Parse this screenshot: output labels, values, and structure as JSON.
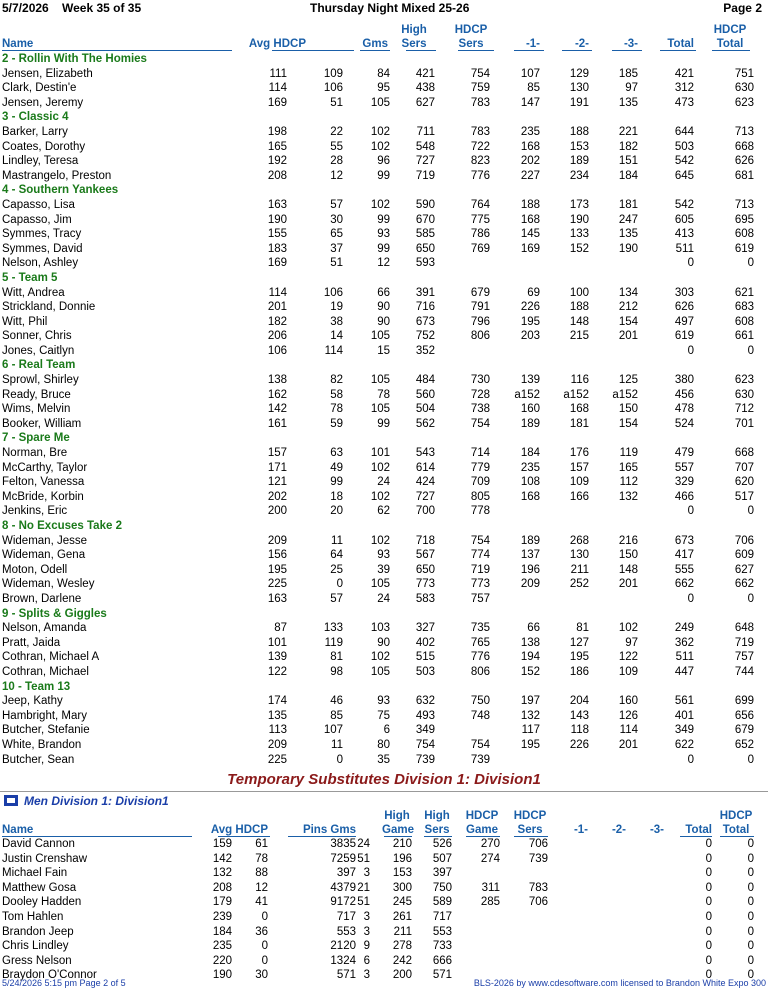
{
  "header": {
    "date": "5/7/2026",
    "week": "Week 35 of 35",
    "title": "Thursday Night Mixed 25-26",
    "page": "Page 2"
  },
  "columns": {
    "name": "Name",
    "avg_hdcp": "Avg HDCP",
    "gms": "Gms",
    "high_sers": "High Sers",
    "hdcp_sers": "HDCP Sers",
    "g1": "-1-",
    "g2": "-2-",
    "g3": "-3-",
    "total": "Total",
    "hdcp_total": "HDCP Total"
  },
  "teams": [
    {
      "name": "2 - Rollin With The Homies",
      "bowlers": [
        [
          "Jensen, Elizabeth",
          "111",
          "109",
          "84",
          "421",
          "754",
          "107",
          "129",
          "185",
          "421",
          "751"
        ],
        [
          "Clark, Destin'e",
          "114",
          "106",
          "95",
          "438",
          "759",
          "85",
          "130",
          "97",
          "312",
          "630"
        ],
        [
          "Jensen, Jeremy",
          "169",
          "51",
          "105",
          "627",
          "783",
          "147",
          "191",
          "135",
          "473",
          "623"
        ]
      ]
    },
    {
      "name": "3 - Classic 4",
      "bowlers": [
        [
          "Barker, Larry",
          "198",
          "22",
          "102",
          "711",
          "783",
          "235",
          "188",
          "221",
          "644",
          "713"
        ],
        [
          "Coates, Dorothy",
          "165",
          "55",
          "102",
          "548",
          "722",
          "168",
          "153",
          "182",
          "503",
          "668"
        ],
        [
          "Lindley, Teresa",
          "192",
          "28",
          "96",
          "727",
          "823",
          "202",
          "189",
          "151",
          "542",
          "626"
        ],
        [
          "Mastrangelo, Preston",
          "208",
          "12",
          "99",
          "719",
          "776",
          "227",
          "234",
          "184",
          "645",
          "681"
        ]
      ]
    },
    {
      "name": "4 - Southern Yankees",
      "bowlers": [
        [
          "Capasso, Lisa",
          "163",
          "57",
          "102",
          "590",
          "764",
          "188",
          "173",
          "181",
          "542",
          "713"
        ],
        [
          "Capasso, Jim",
          "190",
          "30",
          "99",
          "670",
          "775",
          "168",
          "190",
          "247",
          "605",
          "695"
        ],
        [
          "Symmes, Tracy",
          "155",
          "65",
          "93",
          "585",
          "786",
          "145",
          "133",
          "135",
          "413",
          "608"
        ],
        [
          "Symmes, David",
          "183",
          "37",
          "99",
          "650",
          "769",
          "169",
          "152",
          "190",
          "511",
          "619"
        ],
        [
          "Nelson, Ashley",
          "169",
          "51",
          "12",
          "593",
          "",
          "",
          "",
          "",
          "0",
          "0"
        ]
      ]
    },
    {
      "name": "5 - Team 5",
      "bowlers": [
        [
          "Witt, Andrea",
          "114",
          "106",
          "66",
          "391",
          "679",
          "69",
          "100",
          "134",
          "303",
          "621"
        ],
        [
          "Strickland, Donnie",
          "201",
          "19",
          "90",
          "716",
          "791",
          "226",
          "188",
          "212",
          "626",
          "683"
        ],
        [
          "Witt, Phil",
          "182",
          "38",
          "90",
          "673",
          "796",
          "195",
          "148",
          "154",
          "497",
          "608"
        ],
        [
          "Sonner, Chris",
          "206",
          "14",
          "105",
          "752",
          "806",
          "203",
          "215",
          "201",
          "619",
          "661"
        ],
        [
          "Jones, Caitlyn",
          "106",
          "114",
          "15",
          "352",
          "",
          "",
          "",
          "",
          "0",
          "0"
        ]
      ]
    },
    {
      "name": "6 - Real Team",
      "bowlers": [
        [
          "Sprowl, Shirley",
          "138",
          "82",
          "105",
          "484",
          "730",
          "139",
          "116",
          "125",
          "380",
          "623"
        ],
        [
          "Ready, Bruce",
          "162",
          "58",
          "78",
          "560",
          "728",
          "a152",
          "a152",
          "a152",
          "456",
          "630"
        ],
        [
          "Wims, Melvin",
          "142",
          "78",
          "105",
          "504",
          "738",
          "160",
          "168",
          "150",
          "478",
          "712"
        ],
        [
          "Booker, William",
          "161",
          "59",
          "99",
          "562",
          "754",
          "189",
          "181",
          "154",
          "524",
          "701"
        ]
      ]
    },
    {
      "name": "7 - Spare Me",
      "bowlers": [
        [
          "Norman, Bre",
          "157",
          "63",
          "101",
          "543",
          "714",
          "184",
          "176",
          "119",
          "479",
          "668"
        ],
        [
          "McCarthy, Taylor",
          "171",
          "49",
          "102",
          "614",
          "779",
          "235",
          "157",
          "165",
          "557",
          "707"
        ],
        [
          "Felton, Vanessa",
          "121",
          "99",
          "24",
          "424",
          "709",
          "108",
          "109",
          "112",
          "329",
          "620"
        ],
        [
          "McBride, Korbin",
          "202",
          "18",
          "102",
          "727",
          "805",
          "168",
          "166",
          "132",
          "466",
          "517"
        ],
        [
          "Jenkins, Eric",
          "200",
          "20",
          "62",
          "700",
          "778",
          "",
          "",
          "",
          "0",
          "0"
        ]
      ]
    },
    {
      "name": "8 - No Excuses Take 2",
      "bowlers": [
        [
          "Wideman, Jesse",
          "209",
          "11",
          "102",
          "718",
          "754",
          "189",
          "268",
          "216",
          "673",
          "706"
        ],
        [
          "Wideman, Gena",
          "156",
          "64",
          "93",
          "567",
          "774",
          "137",
          "130",
          "150",
          "417",
          "609"
        ],
        [
          "Moton, Odell",
          "195",
          "25",
          "39",
          "650",
          "719",
          "196",
          "211",
          "148",
          "555",
          "627"
        ],
        [
          "Wideman, Wesley",
          "225",
          "0",
          "105",
          "773",
          "773",
          "209",
          "252",
          "201",
          "662",
          "662"
        ],
        [
          "Brown, Darlene",
          "163",
          "57",
          "24",
          "583",
          "757",
          "",
          "",
          "",
          "0",
          "0"
        ]
      ]
    },
    {
      "name": "9 - Splits & Giggles",
      "bowlers": [
        [
          "Nelson, Amanda",
          "87",
          "133",
          "103",
          "327",
          "735",
          "66",
          "81",
          "102",
          "249",
          "648"
        ],
        [
          "Pratt, Jaida",
          "101",
          "119",
          "90",
          "402",
          "765",
          "138",
          "127",
          "97",
          "362",
          "719"
        ],
        [
          "Cothran, Michael A",
          "139",
          "81",
          "102",
          "515",
          "776",
          "194",
          "195",
          "122",
          "511",
          "757"
        ],
        [
          "Cothran, Michael",
          "122",
          "98",
          "105",
          "503",
          "806",
          "152",
          "186",
          "109",
          "447",
          "744"
        ]
      ]
    },
    {
      "name": "10 - Team 13",
      "bowlers": [
        [
          "Jeep, Kathy",
          "174",
          "46",
          "93",
          "632",
          "750",
          "197",
          "204",
          "160",
          "561",
          "699"
        ],
        [
          "Hambright, Mary",
          "135",
          "85",
          "75",
          "493",
          "748",
          "132",
          "143",
          "126",
          "401",
          "656"
        ],
        [
          "Butcher, Stefanie",
          "113",
          "107",
          "6",
          "349",
          "",
          "117",
          "118",
          "114",
          "349",
          "679"
        ],
        [
          "White, Brandon",
          "209",
          "11",
          "80",
          "754",
          "754",
          "195",
          "226",
          "201",
          "622",
          "652"
        ],
        [
          "Butcher, Sean",
          "225",
          "0",
          "35",
          "739",
          "739",
          "",
          "",
          "",
          "0",
          "0"
        ]
      ]
    }
  ],
  "subs_title": "Temporary Substitutes   Division 1: Division1",
  "subs_division": "Men   Division 1: Division1",
  "subs_columns": {
    "name": "Name",
    "avg_hdcp": "Avg HDCP",
    "pins_gms": "Pins  Gms",
    "high_game": "High Game",
    "high_sers": "High Sers",
    "hdcp_game": "HDCP Game",
    "hdcp_sers": "HDCP Sers",
    "g1": "-1-",
    "g2": "-2-",
    "g3": "-3-",
    "total": "Total",
    "hdcp_total": "HDCP Total"
  },
  "subs": [
    [
      "David Cannon",
      "159",
      "61",
      "3835",
      "24",
      "210",
      "526",
      "270",
      "706",
      "0",
      "0"
    ],
    [
      "Justin Crenshaw",
      "142",
      "78",
      "7259",
      "51",
      "196",
      "507",
      "274",
      "739",
      "0",
      "0"
    ],
    [
      "Michael Fain",
      "132",
      "88",
      "397",
      "3",
      "153",
      "397",
      "",
      "",
      "0",
      "0"
    ],
    [
      "Matthew Gosa",
      "208",
      "12",
      "4379",
      "21",
      "300",
      "750",
      "311",
      "783",
      "0",
      "0"
    ],
    [
      "Dooley Hadden",
      "179",
      "41",
      "9172",
      "51",
      "245",
      "589",
      "285",
      "706",
      "0",
      "0"
    ],
    [
      "Tom Hahlen",
      "239",
      "0",
      "717",
      "3",
      "261",
      "717",
      "",
      "",
      "0",
      "0"
    ],
    [
      "Brandon Jeep",
      "184",
      "36",
      "553",
      "3",
      "211",
      "553",
      "",
      "",
      "0",
      "0"
    ],
    [
      "Chris Lindley",
      "235",
      "0",
      "2120",
      "9",
      "278",
      "733",
      "",
      "",
      "0",
      "0"
    ],
    [
      "Gress Nelson",
      "220",
      "0",
      "1324",
      "6",
      "242",
      "666",
      "",
      "",
      "0",
      "0"
    ],
    [
      "Braydon O'Connor",
      "190",
      "30",
      "571",
      "3",
      "200",
      "571",
      "",
      "",
      "0",
      "0"
    ]
  ],
  "footer": {
    "left": "5/24/2026  5:15 pm  Page 2 of 5",
    "right": "BLS-2026 by www.cdesoftware.com licensed to Brandon White  Expo 300"
  }
}
